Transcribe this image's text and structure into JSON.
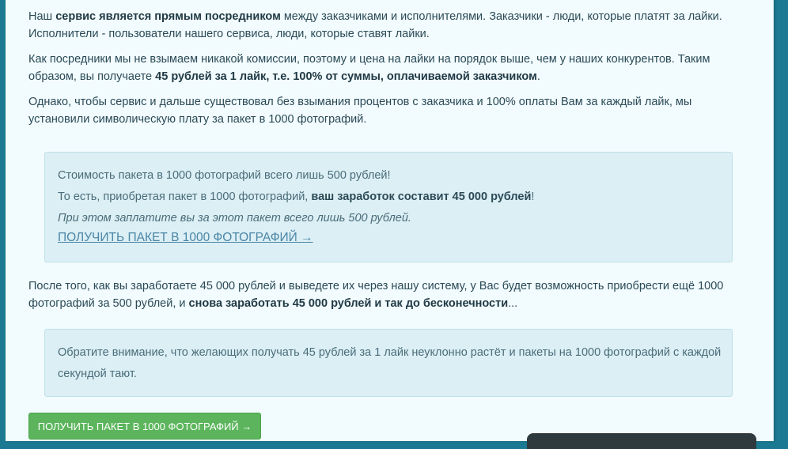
{
  "paragraphs": {
    "p1": {
      "t1": "Наш ",
      "b1": "сервис является прямым посредником",
      "t2": " между заказчиками и исполнителями. Заказчики - люди, которые платят за лайки. Исполнители - пользователи нашего сервиса, люди, которые ставят лайки."
    },
    "p2": {
      "t1": "Как посредники мы не взымаем никакой комиссии, поэтому и цена на лайки на порядок выше, чем у наших конкурентов. Таким образом, вы получаете ",
      "b1": "45 рублей за 1 лайк, т.е. 100% от суммы, оплачиваемой заказчиком",
      "t2": "."
    },
    "p3": {
      "t1": "Однако, чтобы сервис и дальше существовал без взымания процентов с заказчика и 100% оплаты Вам за каждый лайк, мы установили символическую плату за пакет в 1000 фотографий."
    },
    "p4": {
      "t1": "После того, как вы заработаете 45 000 рублей и выведете их через нашу систему, у Вас будет возможность приобрести ещё 1000 фотографий за 500 рублей, и ",
      "b1": "снова заработать 45 000 рублей и так до бесконечности",
      "t2": "..."
    }
  },
  "box1": {
    "line1": "Стоимость пакета в 1000 фотографий всего лишь 500 рублей!",
    "line2_t1": "То есть, приобретая пакет в 1000 фотографий, ",
    "line2_b1": "ваш заработок составит 45 000 рублей",
    "line2_t2": "!",
    "line3": "При этом заплатите вы за этот пакет всего лишь 500 рублей.",
    "link": "ПОЛУЧИТЬ ПАКЕТ В 1000 ФОТОГРАФИЙ →"
  },
  "box2": {
    "text": "Обратите внимание, что желающих получать 45 рублей за 1 лайк неуклонно растёт и пакеты на 1000 фотографий с каждой секундой тают."
  },
  "cta": {
    "label": "ПОЛУЧИТЬ ПАКЕТ В 1000 ФОТОГРАФИЙ →"
  },
  "colors": {
    "background": "#1b7a92",
    "panel": "#f2fbfd",
    "box": "#dbeff5",
    "cta": "#5cb55c",
    "link": "#4b86a5"
  }
}
